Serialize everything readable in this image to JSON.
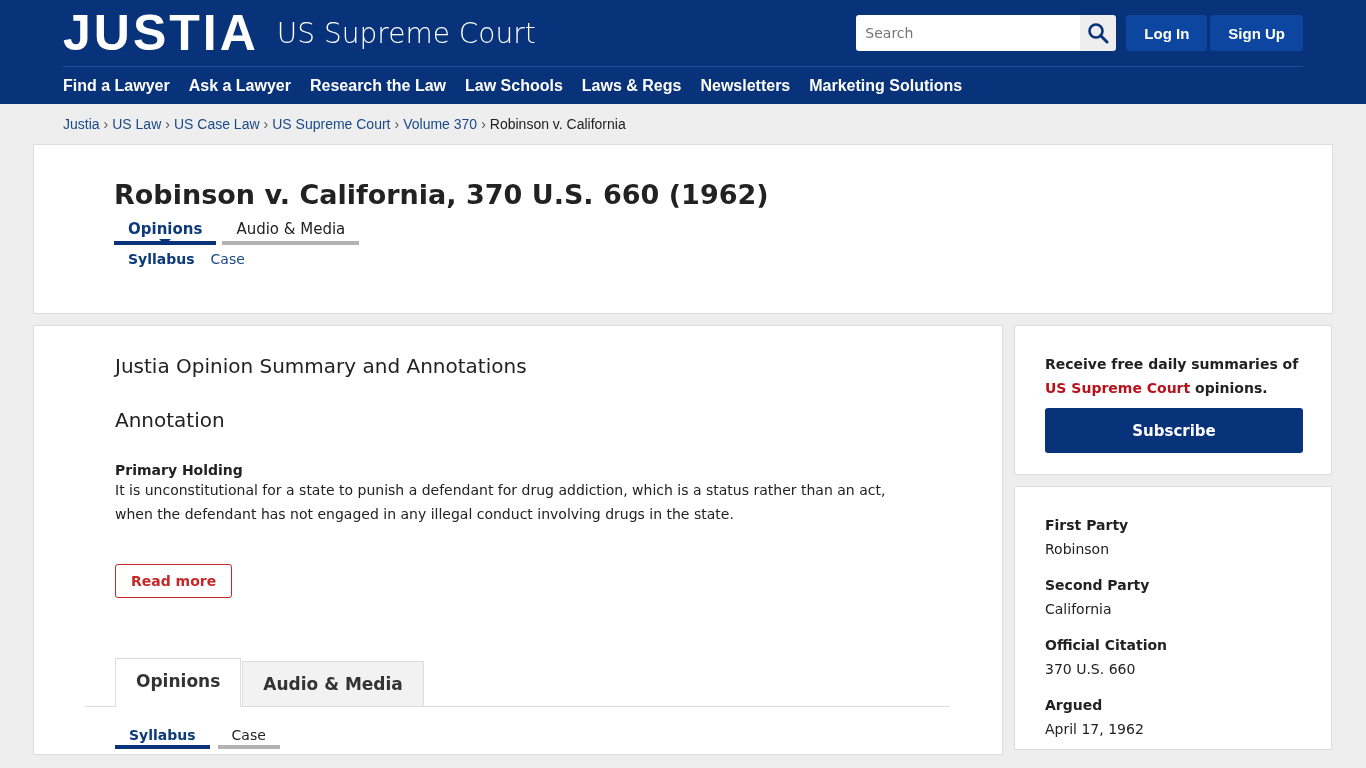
{
  "header": {
    "logo": "JUSTIA",
    "section": "US Supreme Court",
    "search": {
      "placeholder": "Search"
    },
    "buttons": [
      "Log In",
      "Sign Up"
    ]
  },
  "nav": [
    "Find a Lawyer",
    "Ask a Lawyer",
    "Research the Law",
    "Law Schools",
    "Laws & Regs",
    "Newsletters",
    "Marketing Solutions"
  ],
  "breadcrumb": [
    {
      "label": "Justia",
      "link": true,
      "separator": "›"
    },
    {
      "label": "US Law",
      "link": true,
      "separator": "›"
    },
    {
      "label": "US Case Law",
      "link": true,
      "separator": "›"
    },
    {
      "label": "US Supreme Court",
      "link": true,
      "separator": "›"
    },
    {
      "label": "Volume 370",
      "link": true,
      "separator": "›"
    },
    {
      "label": "Robinson v. California",
      "link": false
    }
  ],
  "case_title": "Robinson v. California, 370 U.S. 660 (1962)",
  "top_tabs": [
    {
      "label": "Opinions",
      "selected": true
    },
    {
      "label": "Audio & Media",
      "selected": false
    }
  ],
  "top_subtabs": [
    {
      "label": "Syllabus",
      "selected": true
    },
    {
      "label": "Case",
      "selected": false
    }
  ],
  "summary": {
    "heading": "Justia Opinion Summary and Annotations",
    "subheading": "Annotation",
    "holding_label": "Primary Holding",
    "holding_text": "It is unconstitutional for a state to punish a defendant for drug addiction, which is a status rather than an act, when the defendant has not engaged in any illegal conduct involving drugs in the state.",
    "read_more": "Read more"
  },
  "lower_tabs": [
    {
      "label": "Opinions",
      "selected": true
    },
    {
      "label": "Audio & Media",
      "selected": false
    }
  ],
  "lower_subtabs": [
    {
      "label": "Syllabus",
      "selected": true
    },
    {
      "label": "Case",
      "selected": false
    }
  ],
  "subscribe": {
    "text_before": "Receive free daily summaries of",
    "link": "US Supreme Court",
    "text_after": "opinions.",
    "button": "Subscribe"
  },
  "case_facts": [
    {
      "label": "First Party",
      "value": "Robinson"
    },
    {
      "label": "Second Party",
      "value": "California"
    },
    {
      "label": "Official Citation",
      "value": "370 U.S. 660"
    },
    {
      "label": "Argued",
      "value": "April 17, 1962"
    }
  ]
}
